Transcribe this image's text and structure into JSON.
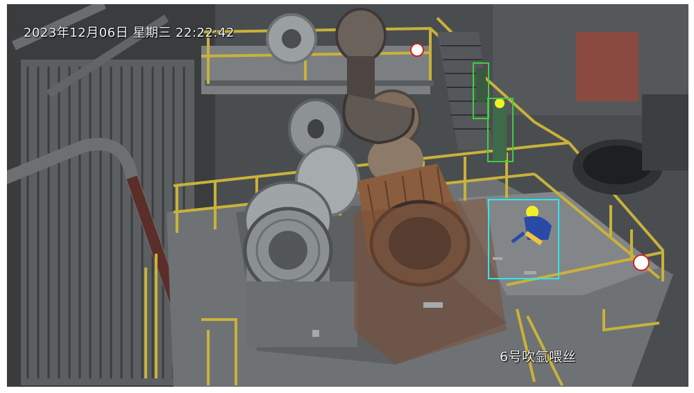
{
  "overlay": {
    "timestamp": "2023年12月06日 星期三 22:22:42",
    "camera_label": "6号吹氩喂丝"
  },
  "detections": [
    {
      "class": "worker",
      "color": "#3bd23b"
    },
    {
      "class": "worker",
      "color": "#3bd23b"
    },
    {
      "class": "worker",
      "color": "#2ee6f2"
    }
  ],
  "colors": {
    "railing": "#c9b23a",
    "floor": "#7b7e80",
    "coil_rust": "#8a5d3e",
    "coil_steel": "#9ea3a6",
    "vest": "#f2f026",
    "jacket": "#2a4aa8"
  }
}
